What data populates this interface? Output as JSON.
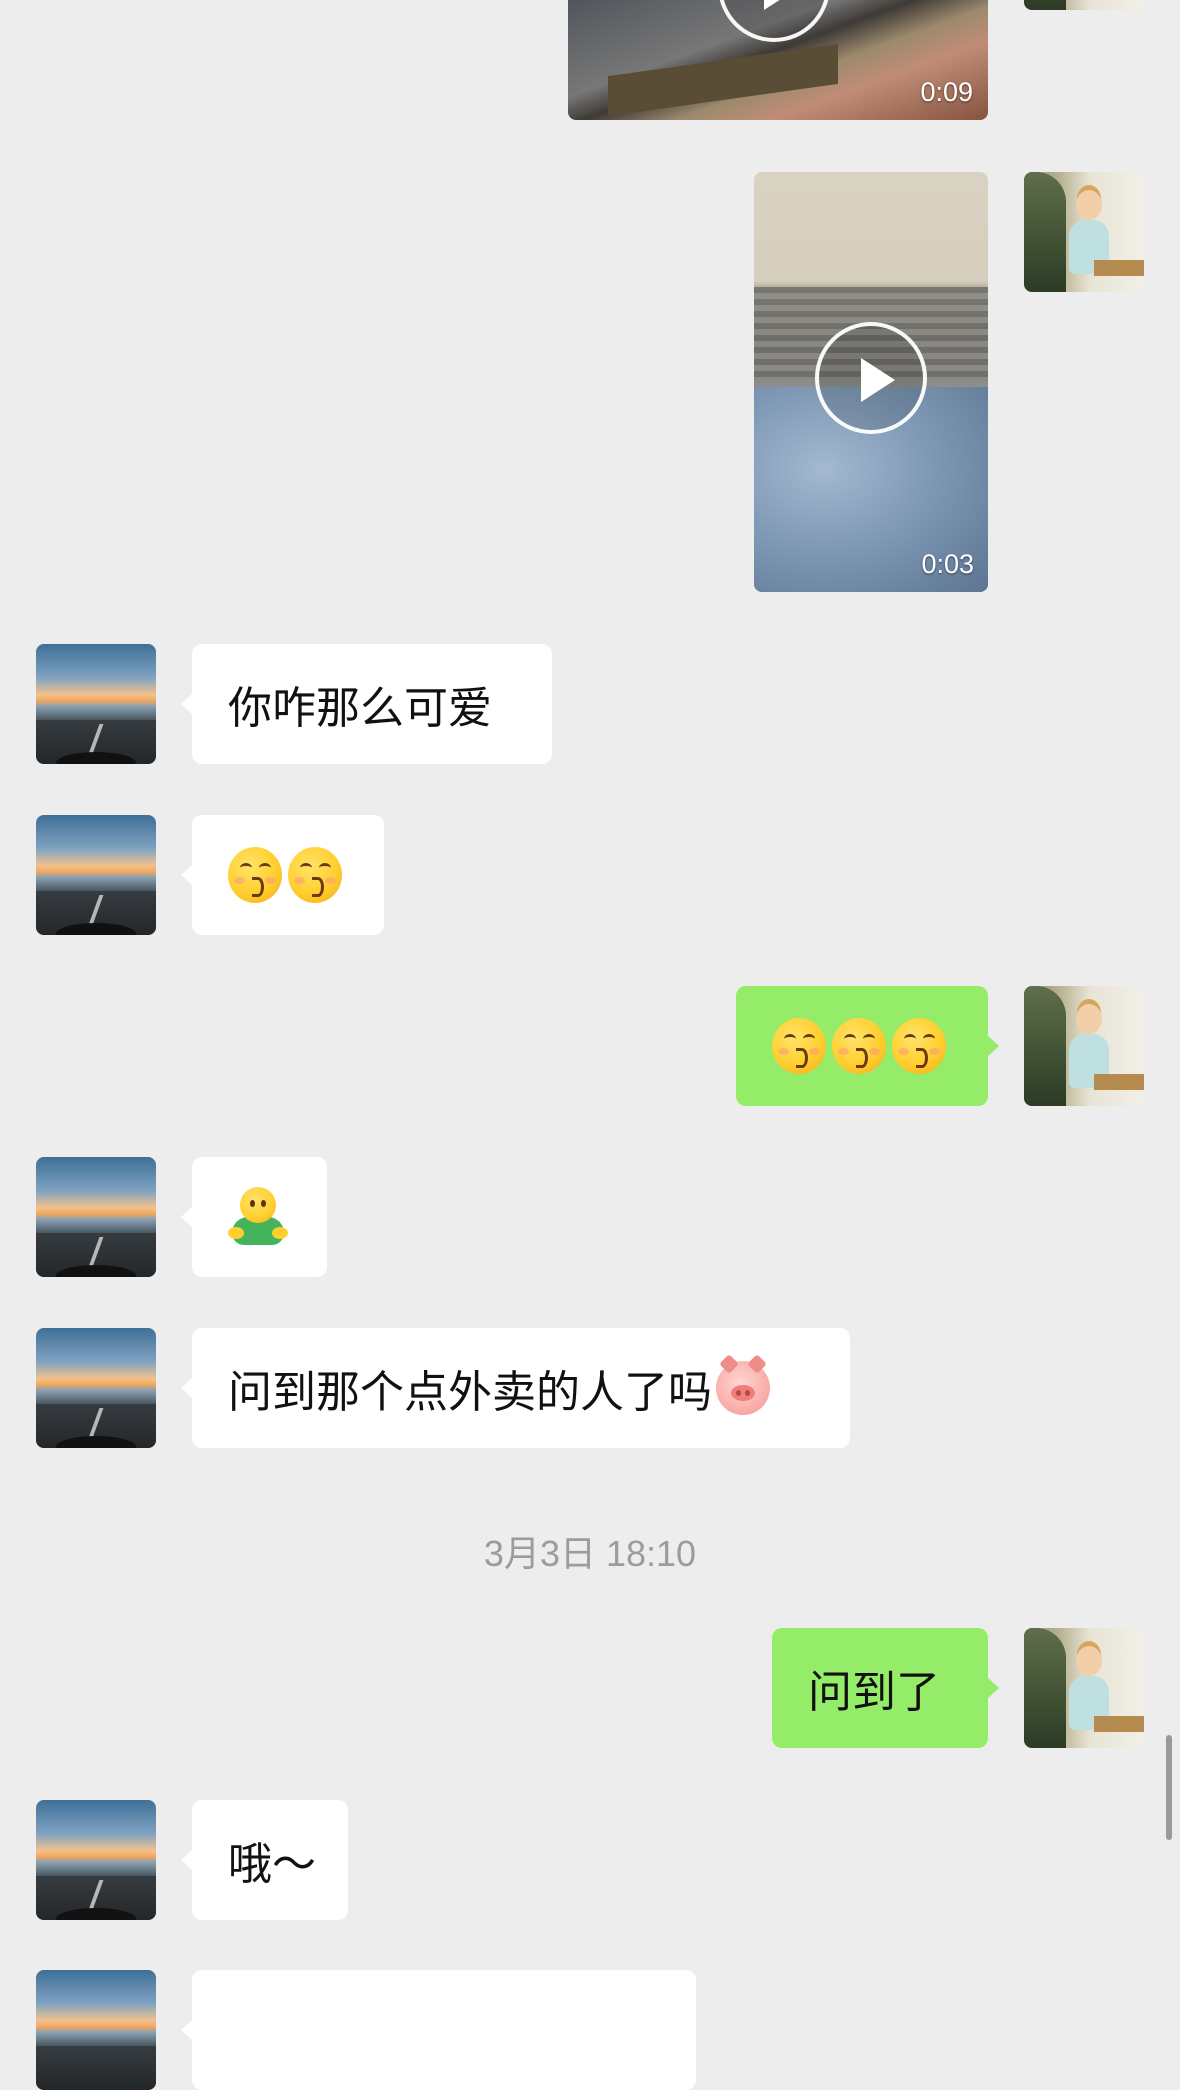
{
  "chat": {
    "messages": [
      {
        "id": "m1",
        "side": "me",
        "type": "video",
        "duration": "0:09"
      },
      {
        "id": "m2",
        "side": "me",
        "type": "video",
        "duration": "0:03"
      },
      {
        "id": "m3",
        "side": "them",
        "type": "text",
        "text": "你咋那么可爱"
      },
      {
        "id": "m4",
        "side": "them",
        "type": "emoji",
        "emoji": [
          "kissing-smiling-eyes",
          "kissing-smiling-eyes"
        ]
      },
      {
        "id": "m5",
        "side": "me",
        "type": "emoji",
        "emoji": [
          "kissing-smiling-eyes",
          "kissing-smiling-eyes",
          "kissing-smiling-eyes"
        ]
      },
      {
        "id": "m6",
        "side": "them",
        "type": "emoji",
        "emoji": [
          "hug"
        ]
      },
      {
        "id": "m7",
        "side": "them",
        "type": "text",
        "text": "问到那个点外卖的人了吗",
        "trailing_emoji": "pig-face"
      },
      {
        "id": "m8",
        "side": "me",
        "type": "text",
        "text": "问到了"
      },
      {
        "id": "m9",
        "side": "them",
        "type": "text",
        "text": "哦～"
      }
    ],
    "timestamp": "3月3日 18:10"
  },
  "colors": {
    "background": "#ededed",
    "bubble_them": "#ffffff",
    "bubble_me": "#95ec69",
    "timestamp_text": "#9c9c9c"
  }
}
